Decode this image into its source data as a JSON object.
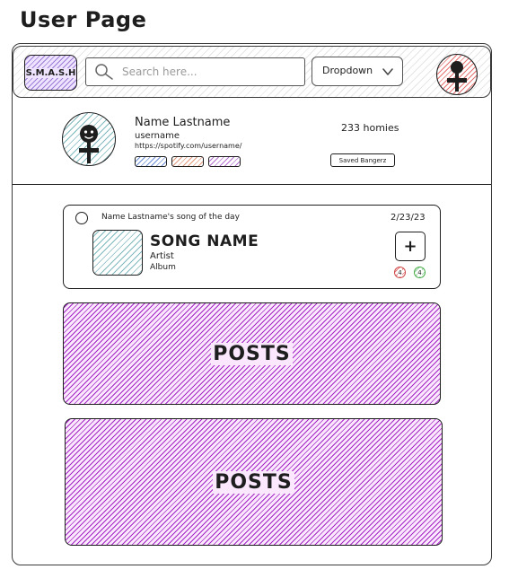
{
  "page": {
    "title": "User Page"
  },
  "navbar": {
    "logo_text": "S.M.A.S.H",
    "search_placeholder": "Search here...",
    "dropdown_label": "Dropdown"
  },
  "profile": {
    "name": "Name Lastname",
    "username": "username",
    "spotify_url": "https://spotify.com/username/",
    "homies_count": "233 homies",
    "saved_button_label": "Saved Bangerz",
    "tag_colors": [
      "#6b8fd6",
      "#e39a7a",
      "#b56fd1"
    ]
  },
  "song_of_day": {
    "header": "Name Lastname's song of the day",
    "date": "2/23/23",
    "song_name": "SONG NAME",
    "artist": "Artist",
    "album": "Album",
    "add_label": "+",
    "downvotes": "4",
    "upvotes": "4"
  },
  "posts": [
    {
      "label": "POSTS"
    },
    {
      "label": "POSTS"
    }
  ],
  "colors": {
    "ink": "#1e1e1e",
    "accent_purple": "#a326c4",
    "logo_purple": "#9b7bd6",
    "teal": "#7fb8bd",
    "red": "#e57373",
    "green": "#8fd19e"
  }
}
